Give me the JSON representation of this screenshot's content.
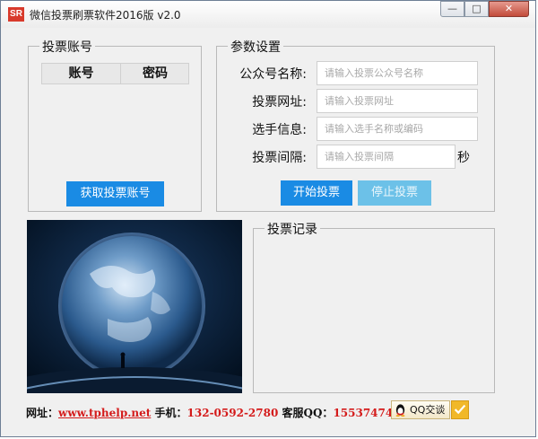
{
  "window": {
    "icon_text": "SR",
    "title": "微信投票刷票软件2016版 v2.0",
    "minimize_glyph": "—",
    "maximize_glyph": "□",
    "close_glyph": "✕"
  },
  "accounts_group": {
    "legend": "投票账号",
    "columns": [
      "账号",
      "密码"
    ],
    "rows": [],
    "fetch_button": "获取投票账号"
  },
  "settings_group": {
    "legend": "参数设置",
    "fields": [
      {
        "label": "公众号名称:",
        "placeholder": "请输入投票公众号名称",
        "value": ""
      },
      {
        "label": "投票网址:",
        "placeholder": "请输入投票网址",
        "value": ""
      },
      {
        "label": "选手信息:",
        "placeholder": "请输入选手名称或编码",
        "value": ""
      },
      {
        "label": "投票间隔:",
        "placeholder": "请输入投票间隔",
        "value": ""
      }
    ],
    "interval_unit": "秒",
    "start_button": "开始投票",
    "stop_button": "停止投票"
  },
  "records_group": {
    "legend": "投票记录",
    "entries": []
  },
  "footer": {
    "site_label": "网址：",
    "site_link": "www.tphelp.net",
    "phone_label": "手机：",
    "phone": "132-0592-2780",
    "qq_label": "客服QQ：",
    "qq": "1553747477",
    "qq_button": "QQ交谈"
  },
  "colors": {
    "primary_button": "#1a8be4",
    "disabled_button": "#6cc1e8",
    "footer_red": "#d41b1b"
  }
}
